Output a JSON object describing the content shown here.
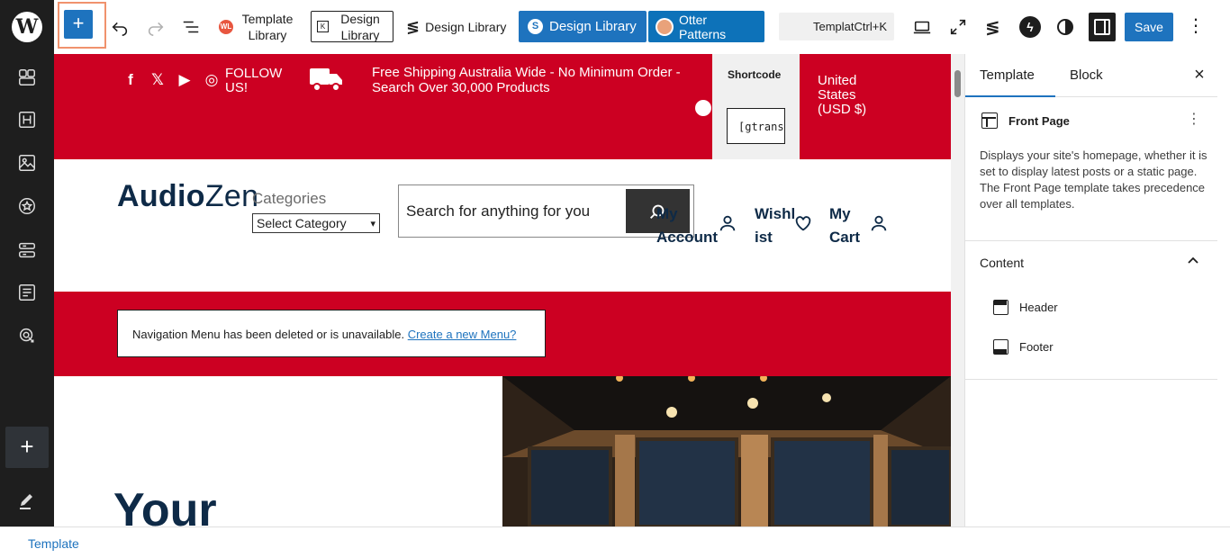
{
  "toolbar": {
    "template_library_label": "Template Library",
    "design_library_outline_label": "Design Library",
    "design_library_plain_label": "Design Library",
    "design_library_blue_label": "Design Library",
    "otter_patterns_label": "Otter Patterns",
    "command_palette_text": "TemplatCtrl+K",
    "save_label": "Save"
  },
  "canvas": {
    "follow_text": "FOLLOW US!",
    "shipping_text": "Free Shipping Australia Wide - No Minimum Order - Search Over 30,000 Products",
    "shortcode_title": "Shortcode",
    "shortcode_value": "[gtransl",
    "currency_text": "United States (USD $)",
    "logo_bold": "Audio",
    "logo_light": "Zen",
    "categories_label": "Categories",
    "category_select_value": "Select Category",
    "search_placeholder": "Search for anything for you",
    "nav_my_account": "My Account",
    "nav_wishlist": "Wishlist",
    "nav_my_cart": "My Cart",
    "notice_text": "Navigation Menu has been deleted or is unavailable.",
    "notice_link": "Create a new Menu?",
    "hero_heading": "Your"
  },
  "panel": {
    "tab_template": "Template",
    "tab_block": "Block",
    "template_name": "Front Page",
    "template_description": "Displays your site's homepage, whether it is set to display latest posts or a static page. The Front Page template takes precedence over all templates.",
    "content_label": "Content",
    "parts": [
      {
        "label": "Header"
      },
      {
        "label": "Footer"
      }
    ]
  },
  "footer": {
    "breadcrumb": "Template"
  },
  "colors": {
    "wp_blue": "#1e73be",
    "brand_red": "#cc0022",
    "brand_navy": "#0e2a47",
    "sidebar_dark": "#1e1e1e",
    "highlight_border": "#f0926d"
  }
}
